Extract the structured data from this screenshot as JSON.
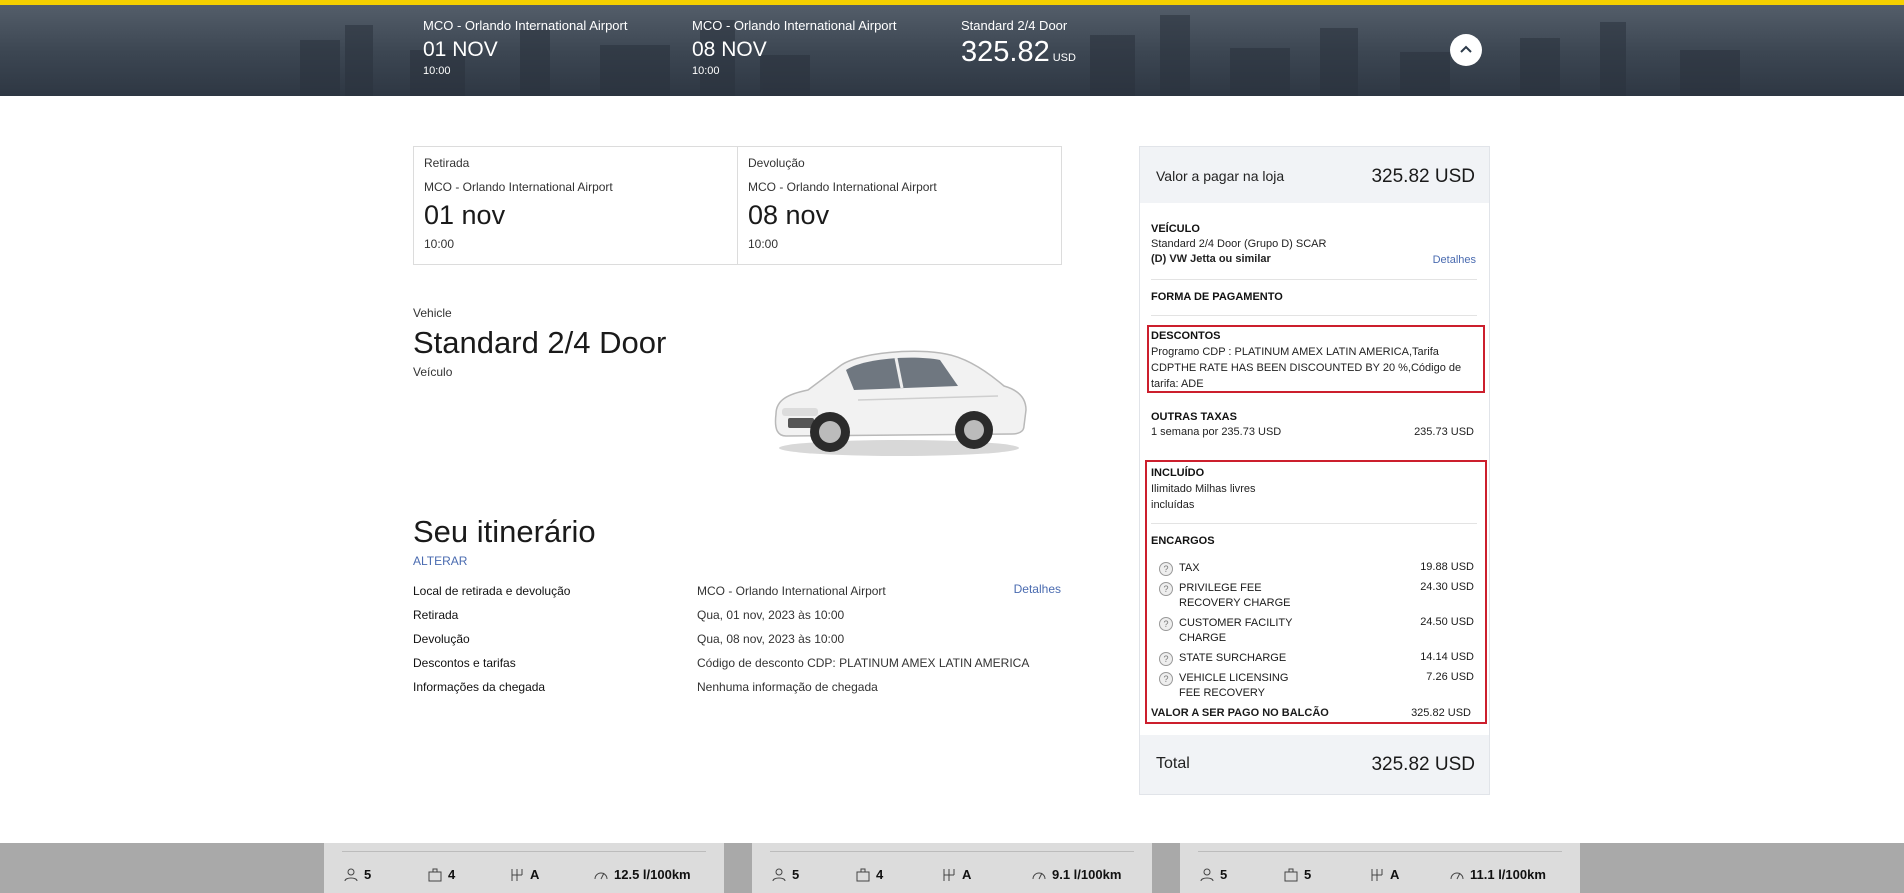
{
  "header": {
    "pickup": {
      "location": "MCO - Orlando International Airport",
      "date": "01 NOV",
      "time": "10:00"
    },
    "return": {
      "location": "MCO - Orlando International Airport",
      "date": "08 NOV",
      "time": "10:00"
    },
    "vehicle": {
      "name": "Standard 2/4 Door",
      "price": "325.82",
      "currency": "USD"
    }
  },
  "summary_card": {
    "pickup": {
      "label": "Retirada",
      "location": "MCO - Orlando International Airport",
      "date": "01 nov",
      "time": "10:00"
    },
    "return": {
      "label": "Devolução",
      "location": "MCO - Orlando International Airport",
      "date": "08 nov",
      "time": "10:00"
    }
  },
  "vehicle": {
    "label": "Vehicle",
    "name": "Standard 2/4 Door",
    "sublabel": "Veículo"
  },
  "itinerary": {
    "title": "Seu itinerário",
    "change_label": "ALTERAR",
    "details_label": "Detalhes",
    "rows": [
      {
        "key": "Local de retirada e devolução",
        "value": "MCO - Orlando International Airport"
      },
      {
        "key": "Retirada",
        "value": "Qua, 01 nov, 2023 às 10:00"
      },
      {
        "key": "Devolução",
        "value": "Qua, 08 nov, 2023 às 10:00"
      },
      {
        "key": "Descontos e tarifas",
        "value": "Código de desconto CDP: PLATINUM AMEX LATIN AMERICA"
      },
      {
        "key": "Informações da chegada",
        "value": "Nenhuma informação de chegada"
      }
    ]
  },
  "panel": {
    "store_label": "Valor a pagar na loja",
    "store_value": "325.82 USD",
    "vehicle_heading": "VEÍCULO",
    "vehicle_line1": "Standard 2/4 Door (Grupo D) SCAR",
    "vehicle_line2": "(D) VW Jetta ou similar",
    "vehicle_details": "Detalhes",
    "payment_heading": "FORMA DE PAGAMENTO",
    "discounts_heading": "DESCONTOS",
    "discounts_text": "Programo CDP : PLATINUM AMEX LATIN AMERICA,Tarifa CDPTHE RATE HAS BEEN DISCOUNTED BY 20 %,Código de tarifa: ADE",
    "other_heading": "OUTRAS TAXAS",
    "other_line": "1 semana por 235.73 USD",
    "other_value": "235.73 USD",
    "included_heading": "INCLUÍDO",
    "included_line1": "Ilimitado Milhas livres",
    "included_line2": "incluídas",
    "charges_heading": "ENCARGOS",
    "charges": [
      {
        "name": "TAX",
        "amount": "19.88 USD"
      },
      {
        "name": "PRIVILEGE FEE RECOVERY CHARGE",
        "amount": "24.30 USD"
      },
      {
        "name": "CUSTOMER FACILITY CHARGE",
        "amount": "24.50 USD"
      },
      {
        "name": "STATE SURCHARGE",
        "amount": "14.14 USD"
      },
      {
        "name": "VEHICLE LICENSING FEE RECOVERY",
        "amount": "7.26 USD"
      }
    ],
    "counter_label": "VALOR A SER PAGO NO BALCÃO",
    "counter_value": "325.82 USD",
    "total_label": "Total",
    "total_value": "325.82 USD"
  },
  "bottom_cards": [
    {
      "passengers": "5",
      "bags": "4",
      "transmission": "A",
      "consumption": "12.5 l/100km"
    },
    {
      "passengers": "5",
      "bags": "4",
      "transmission": "A",
      "consumption": "9.1 l/100km"
    },
    {
      "passengers": "5",
      "bags": "5",
      "transmission": "A",
      "consumption": "11.1 l/100km"
    }
  ],
  "colors": {
    "accent_yellow": "#f5d000",
    "link_blue": "#4a6bb0",
    "highlight_red": "#cc1f2d"
  }
}
